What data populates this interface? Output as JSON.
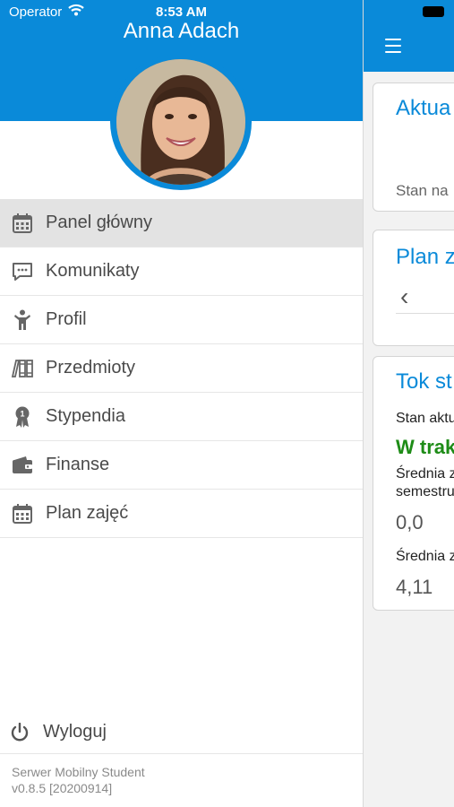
{
  "status_bar": {
    "carrier": "Operator",
    "time": "8:53 AM"
  },
  "drawer": {
    "user_name": "Anna Adach",
    "menu": [
      {
        "label": "Panel główny",
        "icon": "calendar-icon",
        "active": true
      },
      {
        "label": "Komunikaty",
        "icon": "chat-icon"
      },
      {
        "label": "Profil",
        "icon": "person-icon"
      },
      {
        "label": "Przedmioty",
        "icon": "books-icon"
      },
      {
        "label": "Stypendia",
        "icon": "award-icon"
      },
      {
        "label": "Finanse",
        "icon": "wallet-icon"
      },
      {
        "label": "Plan zajęć",
        "icon": "calendar-icon"
      }
    ],
    "logout_label": "Wyloguj",
    "app_name": "Serwer Mobilny Student",
    "version": "v0.8.5 [20200914]"
  },
  "main": {
    "card1": {
      "title": "Aktua",
      "text": "Stan na"
    },
    "card2": {
      "title": "Plan z",
      "nav_prev": "‹"
    },
    "card3": {
      "title": "Tok st",
      "status_label": "Stan aktu",
      "status_value": "W trak",
      "avg1_label_line1": "Średnia z",
      "avg1_label_line2": "semestru",
      "avg1_value": "0,0",
      "avg2_label": "Średnia z",
      "avg2_value": "4,11"
    }
  },
  "colors": {
    "accent": "#0a8ad9",
    "green": "#1e8c17",
    "active_row": "#e3e3e3"
  }
}
